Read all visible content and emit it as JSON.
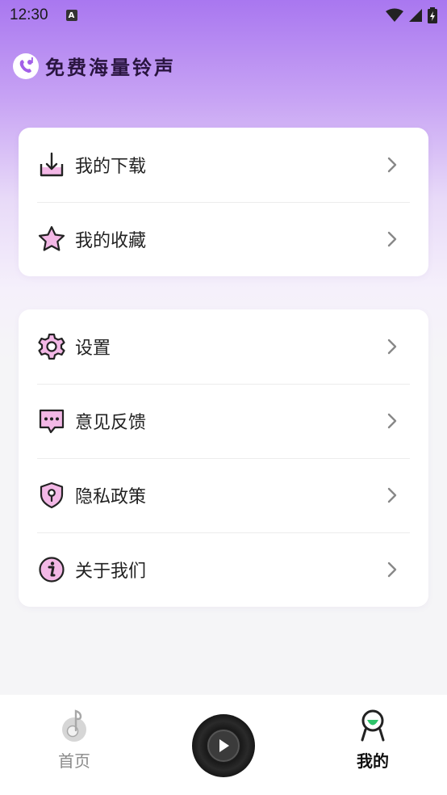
{
  "status": {
    "time": "12:30",
    "badge": "A"
  },
  "app": {
    "title": "免费海量铃声",
    "logo_icon": "phone-music-icon"
  },
  "menu_group_1": [
    {
      "id": "downloads",
      "label": "我的下载",
      "icon": "download-icon"
    },
    {
      "id": "favorites",
      "label": "我的收藏",
      "icon": "star-icon"
    }
  ],
  "menu_group_2": [
    {
      "id": "settings",
      "label": "设置",
      "icon": "gear-icon"
    },
    {
      "id": "feedback",
      "label": "意见反馈",
      "icon": "chat-bubble-icon"
    },
    {
      "id": "privacy",
      "label": "隐私政策",
      "icon": "shield-lock-icon"
    },
    {
      "id": "about",
      "label": "关于我们",
      "icon": "info-icon"
    }
  ],
  "bottom_nav": {
    "home_label": "首页",
    "mine_label": "我的",
    "active": "mine"
  },
  "colors": {
    "accent": "#a977f0",
    "pink_fill": "#f3b8e6",
    "active_green": "#2ec46a"
  }
}
